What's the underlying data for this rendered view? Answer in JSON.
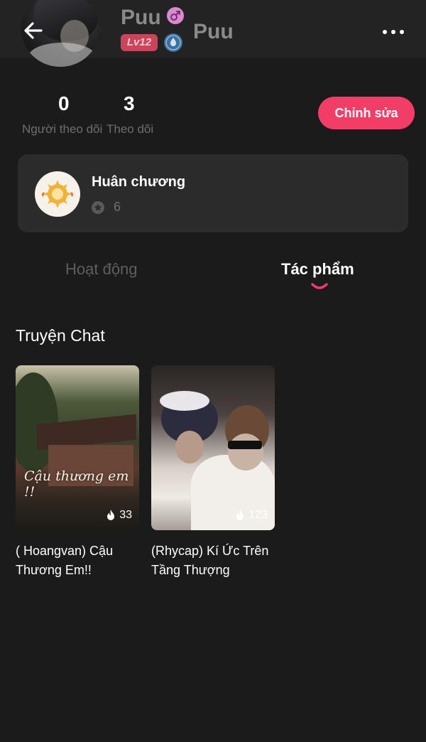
{
  "header": {
    "username": "Puu",
    "level": "Lv12",
    "title_name": "Puu"
  },
  "stats": {
    "followers_count": "0",
    "followers_label": "Người theo dõi",
    "following_count": "3",
    "following_label": "Theo dõi",
    "edit_button": "Chỉnh sửa"
  },
  "medal": {
    "title": "Huân chương",
    "count": "6"
  },
  "tabs": [
    {
      "label": "Hoạt động",
      "active": false
    },
    {
      "label": "Tác phẩm",
      "active": true
    }
  ],
  "section": {
    "title": "Truyện Chat"
  },
  "stories": [
    {
      "title": "( Hoangvan) Cậu Thương Em!!",
      "cover_text": "Cậu thương em !!",
      "likes": "33"
    },
    {
      "title": "(Rhycap) Kí Ức Trên Tầng Thượng",
      "likes": "123"
    }
  ],
  "colors": {
    "accent": "#f23d66",
    "background": "#1b1b1b",
    "card": "#2b2b2b",
    "level_badge": "#c8455b"
  }
}
